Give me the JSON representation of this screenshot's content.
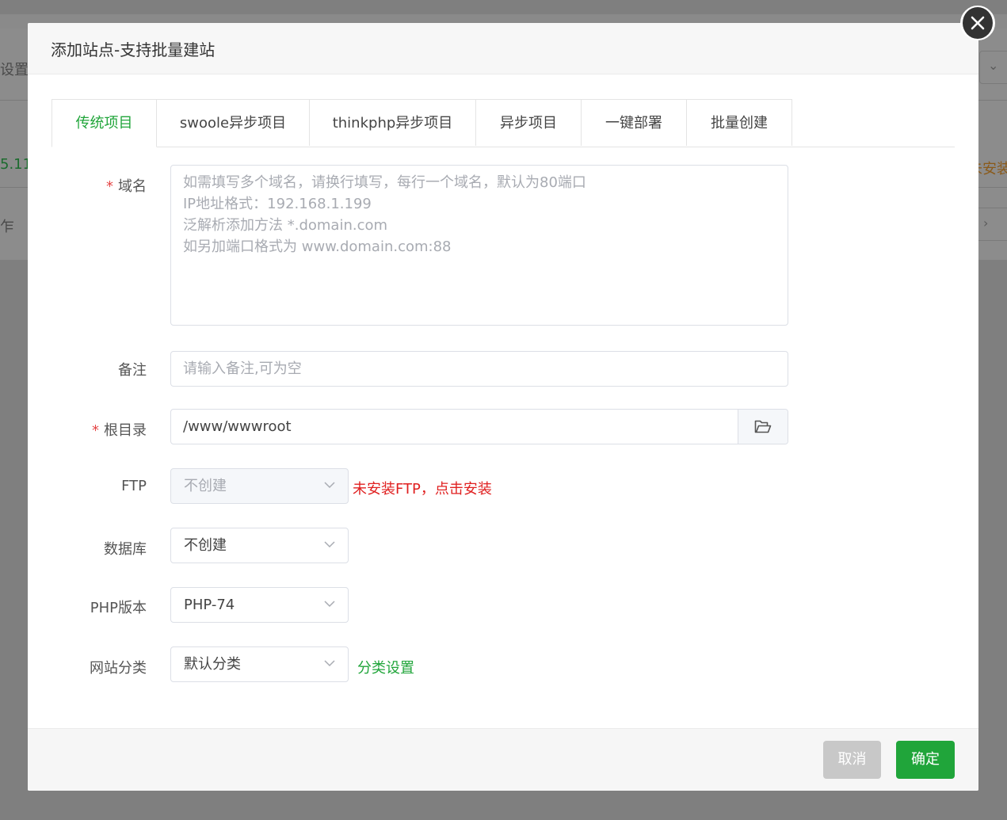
{
  "background": {
    "left_texts": [
      "设置",
      "5.11",
      "乍"
    ],
    "right_text": "未安装"
  },
  "dialog": {
    "title": "添加站点-支持批量建站"
  },
  "tabs": [
    {
      "label": "传统项目",
      "active": true
    },
    {
      "label": "swoole异步项目",
      "active": false
    },
    {
      "label": "thinkphp异步项目",
      "active": false
    },
    {
      "label": "异步项目",
      "active": false
    },
    {
      "label": "一键部署",
      "active": false
    },
    {
      "label": "批量创建",
      "active": false
    }
  ],
  "form": {
    "domain": {
      "label": "域名",
      "required_mark": "*",
      "placeholder_lines": [
        "如需填写多个域名，请换行填写，每行一个域名，默认为80端口",
        "IP地址格式：192.168.1.199",
        "泛解析添加方法 *.domain.com",
        "如另加端口格式为 www.domain.com:88"
      ]
    },
    "remark": {
      "label": "备注",
      "placeholder": "请输入备注,可为空"
    },
    "root": {
      "label": "根目录",
      "required_mark": "*",
      "value": "/www/wwwroot"
    },
    "ftp": {
      "label": "FTP",
      "value": "不创建",
      "disabled": true,
      "hint": "未安装FTP，点击安装"
    },
    "database": {
      "label": "数据库",
      "value": "不创建"
    },
    "php": {
      "label": "PHP版本",
      "value": "PHP-74"
    },
    "category": {
      "label": "网站分类",
      "value": "默认分类",
      "link": "分类设置"
    }
  },
  "footer": {
    "cancel_label": "取消",
    "confirm_label": "确定"
  },
  "colors": {
    "accent": "#20a53a",
    "danger": "#e02020",
    "required": "#e54545"
  }
}
